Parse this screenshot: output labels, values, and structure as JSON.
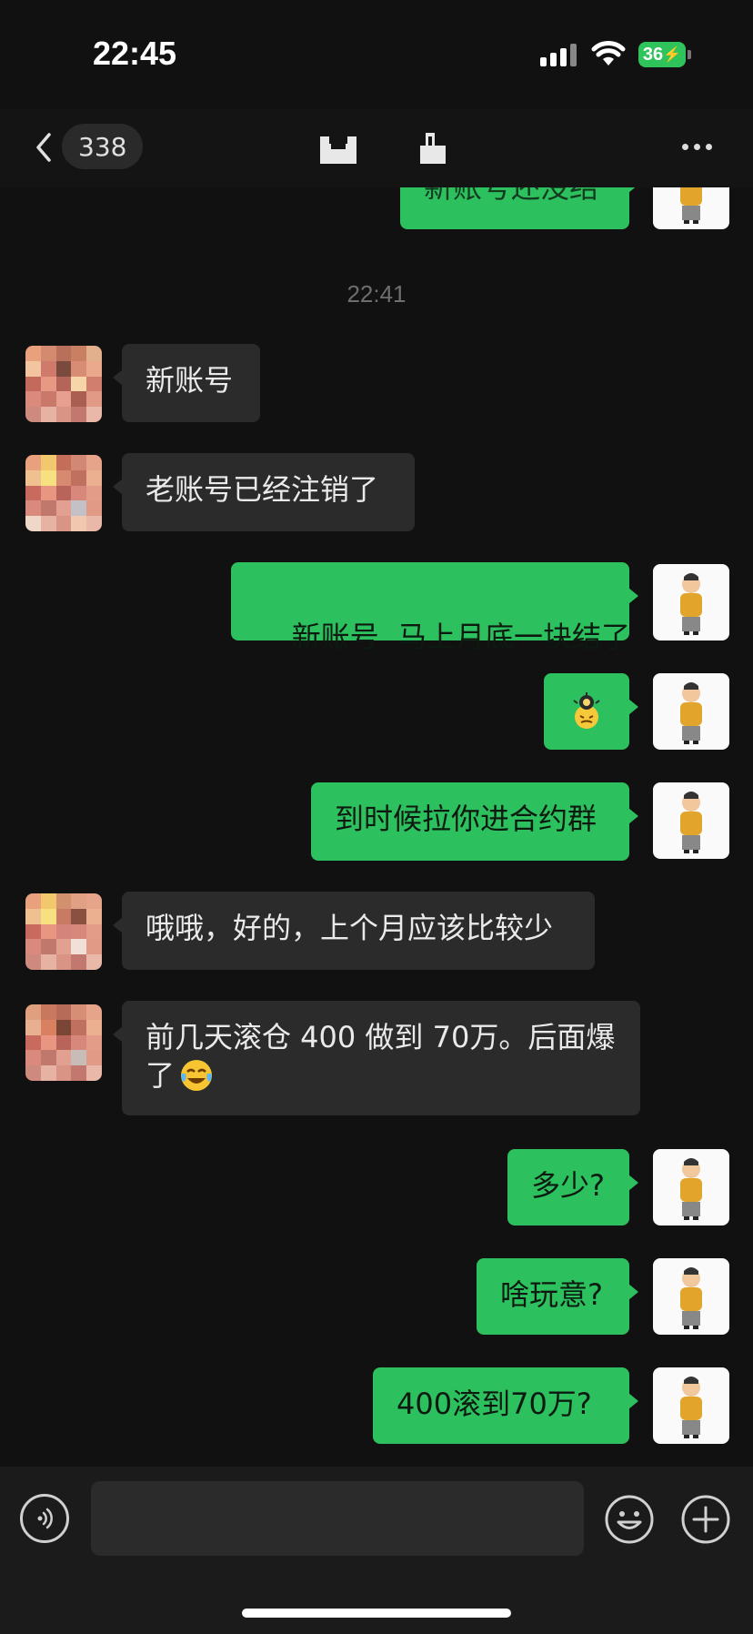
{
  "status": {
    "time": "22:45",
    "battery": "36"
  },
  "nav": {
    "unread_count": "338"
  },
  "chat": {
    "timestamp": "22:41",
    "partial_top": "新账号还没结",
    "messages": [
      {
        "text": "新账号"
      },
      {
        "text": "老账号已经注销了"
      },
      {
        "text": "新账号  马上月底一块结了"
      },
      {
        "text": ""
      },
      {
        "text": "到时候拉你进合约群"
      },
      {
        "text": "哦哦，好的，上个月应该比较少"
      },
      {
        "text_line1": "前几天滚仓 400 做到 70万。后面爆",
        "text_line2": "了"
      },
      {
        "text": "多少?"
      },
      {
        "text": "啥玩意?"
      },
      {
        "text": "400滚到70万?"
      }
    ]
  },
  "input": {
    "placeholder": ""
  },
  "icons": {
    "back": "chevron-left-icon",
    "more": "more-dots-icon",
    "voice": "voice-icon",
    "emoji": "emoji-icon",
    "plus": "plus-icon"
  },
  "colors": {
    "self_bubble": "#2dc05e",
    "other_bubble": "#2b2b2b",
    "background": "#111111"
  }
}
